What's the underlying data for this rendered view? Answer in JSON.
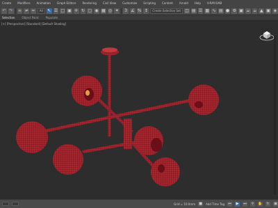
{
  "menubar": {
    "items": [
      {
        "label": "Create"
      },
      {
        "label": "Modifiers"
      },
      {
        "label": "Animation"
      },
      {
        "label": "Graph Editors"
      },
      {
        "label": "Rendering"
      },
      {
        "label": "Civil View"
      },
      {
        "label": "Customize"
      },
      {
        "label": "Scripting"
      },
      {
        "label": "Content"
      },
      {
        "label": "Arnold"
      },
      {
        "label": "Help"
      },
      {
        "label": "V-RAY/UAB"
      }
    ]
  },
  "toolbar": {
    "selection_filter": "All",
    "named_selection": "Create Selection Set"
  },
  "ribbon": {
    "tabs": [
      {
        "label": "Selection"
      },
      {
        "label": "Object Paint"
      },
      {
        "label": "Populate"
      }
    ]
  },
  "viewport": {
    "label": "[+] [Perspective] [Standard] [Default Shading]",
    "model_color": "#a5262f",
    "wire_color": "#5e0a12"
  },
  "statusbar": {
    "grid_label": "Grid = 10.0mm",
    "time_tag": "Add Time Tag"
  },
  "colors": {
    "ui_background": "#444444",
    "viewport_background": "#2d2d2d",
    "accent": "#3d6a99"
  }
}
